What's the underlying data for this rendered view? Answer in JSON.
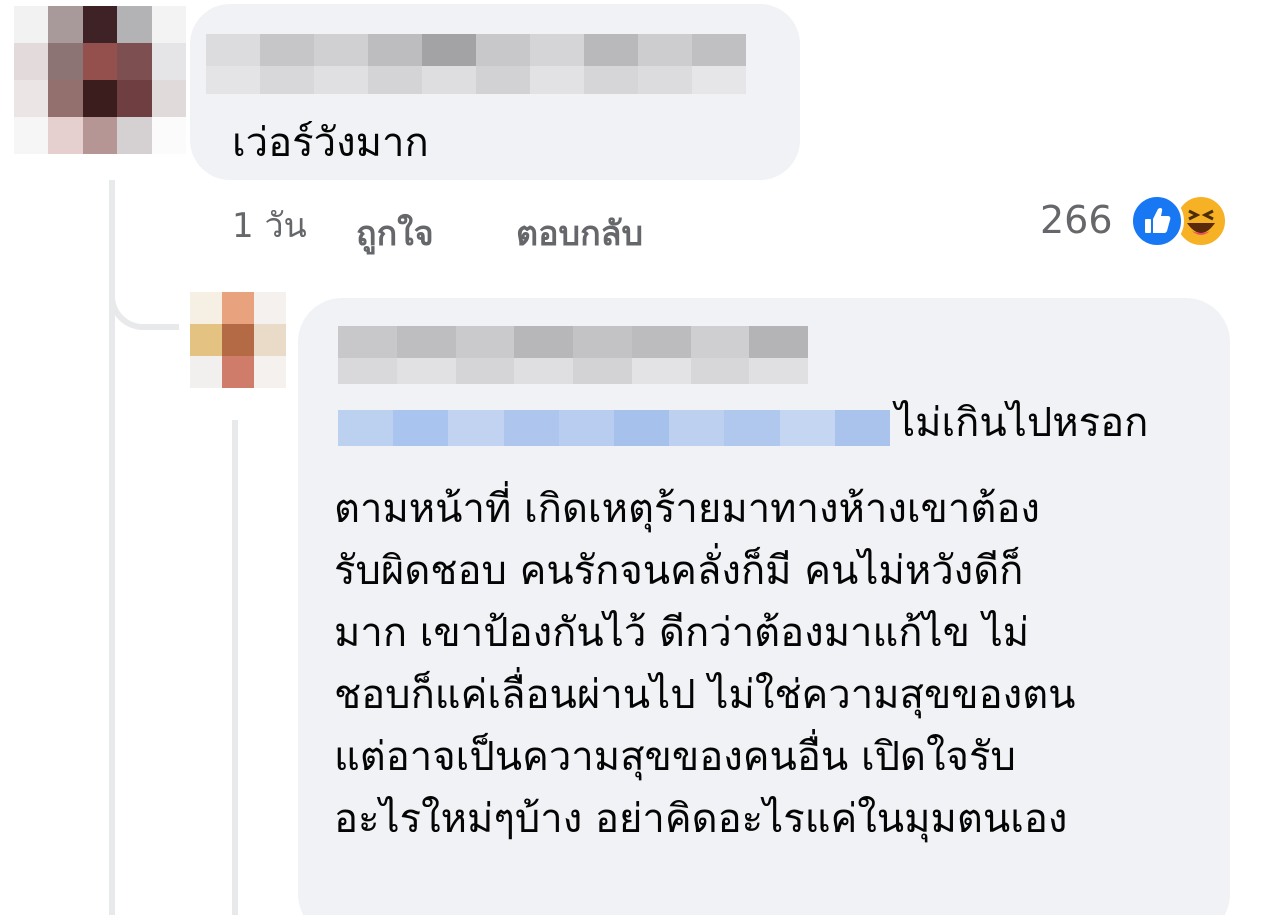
{
  "comments": [
    {
      "text": "เว่อร์วังมาก",
      "time": "1 วัน",
      "like_label": "ถูกใจ",
      "reply_label": "ตอบกลับ",
      "reaction_count": "266",
      "reactions": [
        "like-icon",
        "haha-icon"
      ]
    }
  ],
  "reply": {
    "first_line": "ไม่เกินไปหรอก",
    "lines": [
      "ตามหน้าที่ เกิดเหตุร้ายมาทางห้างเขาต้อง",
      "รับผิดชอบ คนรักจนคลั่งก็มี คนไม่หวังดีก็",
      "มาก เขาป้องกันไว้ ดีกว่าต้องมาแก้ไข ไม่",
      "ชอบก็แค่เลื่อนผ่านไป ไม่ใช่ความสุขของตน",
      "แต่อาจเป็นความสุขของคนอื่น เปิดใจรับ",
      "อะไรใหม่ๆบ้าง อย่าคิดอะไรแค่ในมุมตนเอง"
    ]
  },
  "colors": {
    "bubble": "#f0f2f5",
    "meta_text": "#65676b",
    "like_blue": "#1877f2",
    "haha_yellow": "#f7b125",
    "mention_blur": "#a9c4ee"
  }
}
